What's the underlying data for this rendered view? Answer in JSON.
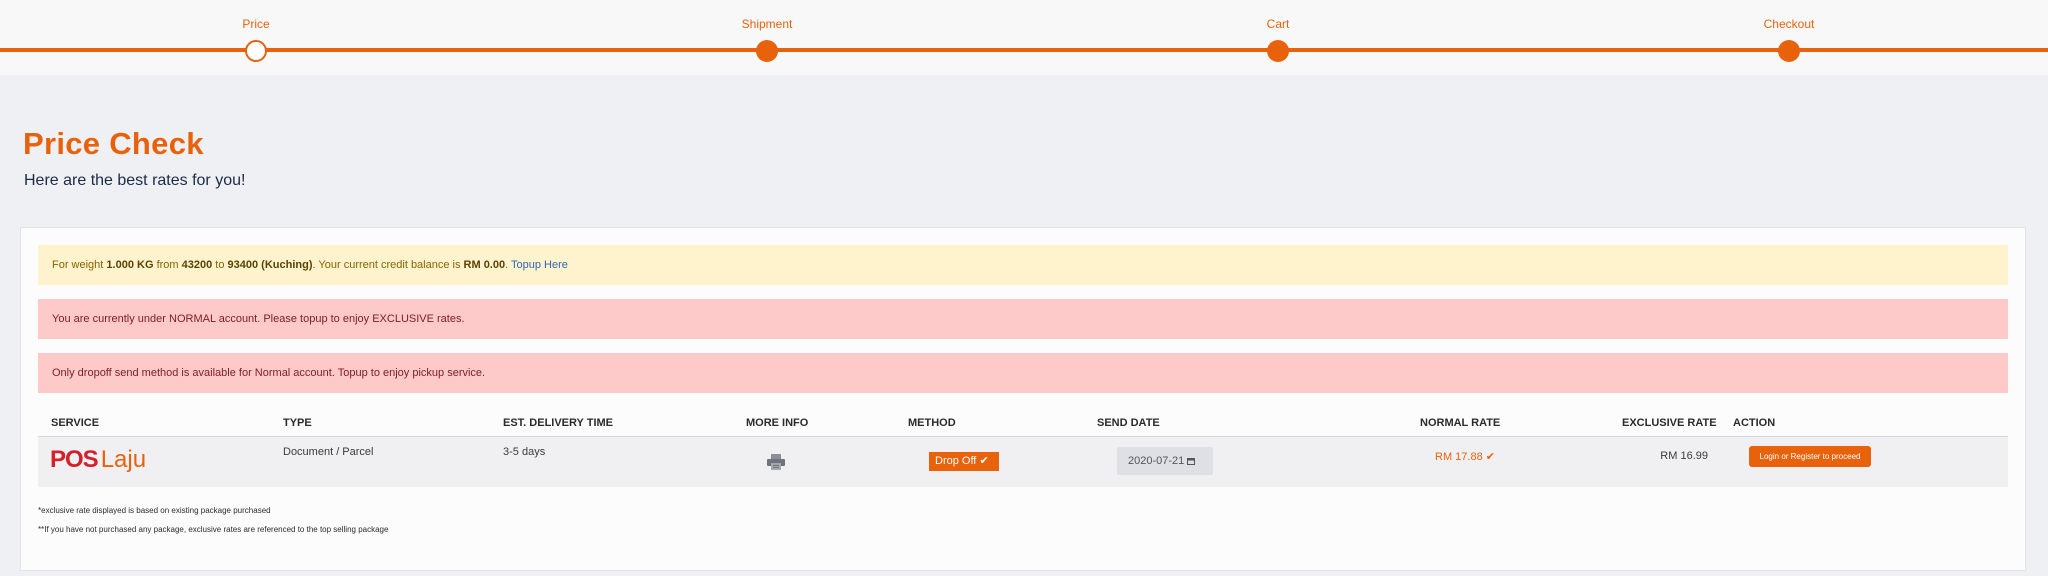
{
  "stepper": {
    "steps": [
      {
        "label": "Price",
        "state": "current"
      },
      {
        "label": "Shipment",
        "state": "done"
      },
      {
        "label": "Cart",
        "state": "done"
      },
      {
        "label": "Checkout",
        "state": "done"
      }
    ]
  },
  "header": {
    "title": "Price Check",
    "subtitle": "Here are the best rates for you!"
  },
  "alerts": {
    "info": {
      "prefix": "For weight ",
      "weight": "1.000 KG",
      "from_label": " from ",
      "from": "43200",
      "to_label": " to ",
      "to": "93400 (Kuching)",
      "balance_label": ". Your current credit balance is ",
      "balance": "RM 0.00",
      "period": ". ",
      "link": "Topup Here"
    },
    "account_warning": "You are currently under NORMAL account. Please topup to enjoy EXCLUSIVE rates.",
    "method_warning": "Only dropoff send method is available for Normal account. Topup to enjoy pickup service."
  },
  "table": {
    "headers": {
      "service": "SERVICE",
      "type": "TYPE",
      "delivery": "EST. DELIVERY TIME",
      "more_info": "MORE INFO",
      "method": "METHOD",
      "send_date": "SEND DATE",
      "normal_rate": "NORMAL RATE",
      "exclusive_rate": "EXCLUSIVE RATE",
      "action": "ACTION"
    },
    "row": {
      "logo_pos": "POS",
      "logo_laju": "Laju",
      "type": "Document / Parcel",
      "delivery": "3-5 days",
      "more_info_icon": "printer-icon",
      "method": "Drop Off",
      "send_date": "2020-07-21",
      "normal_rate": "RM 17.88",
      "exclusive_rate": "RM 16.99",
      "action": "Login or Register to proceed"
    }
  },
  "notes": {
    "note1": "*exclusive rate displayed is based on existing package purchased",
    "note2": "**If you have not purchased any package, exclusive rates are referenced to the top selling package"
  },
  "colors": {
    "accent": "#e8620c",
    "info_bg": "#fff3cd",
    "danger_bg": "#fec9c9"
  }
}
